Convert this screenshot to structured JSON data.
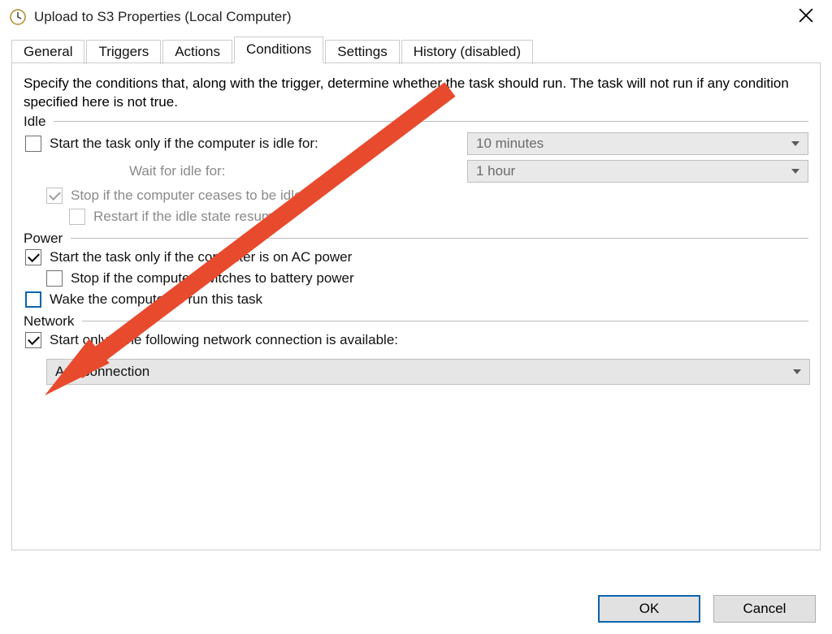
{
  "window": {
    "title": "Upload to S3 Properties (Local Computer)"
  },
  "tabs": {
    "general": "General",
    "triggers": "Triggers",
    "actions": "Actions",
    "conditions": "Conditions",
    "settings": "Settings",
    "history": "History (disabled)"
  },
  "conditions": {
    "description": "Specify the conditions that, along with the trigger, determine whether the task should run.  The task will not run  if any condition specified here is not true.",
    "idle": {
      "section": "Idle",
      "start_idle": "Start the task only if the computer is idle for:",
      "idle_duration": "10 minutes",
      "wait_idle_label": "Wait for idle for:",
      "wait_idle_value": "1 hour",
      "stop_if_cease": "Stop if the computer ceases to be idle",
      "restart_if_resume": "Restart if the idle state resumes"
    },
    "power": {
      "section": "Power",
      "on_ac": "Start the task only if the computer is on AC power",
      "stop_battery": "Stop if the computer switches to battery power",
      "wake": "Wake the computer to run this task"
    },
    "network": {
      "section": "Network",
      "start_if_net": "Start only if the following network connection is available:",
      "connection": "Any connection"
    }
  },
  "buttons": {
    "ok": "OK",
    "cancel": "Cancel"
  }
}
